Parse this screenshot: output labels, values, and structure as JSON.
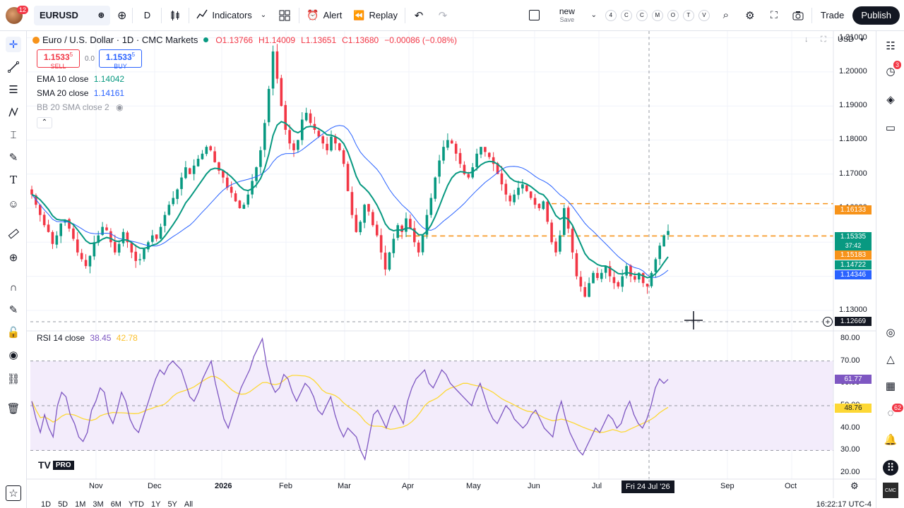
{
  "topbar": {
    "avatar_badge": "12",
    "symbol": "EURUSD",
    "interval": "D",
    "indicators_label": "Indicators",
    "alert_label": "Alert",
    "replay_label": "Replay",
    "layout_name": "new",
    "layout_save": "Save",
    "shortcut_keys": [
      "4",
      "C",
      "C",
      "M",
      "O",
      "T",
      "V"
    ],
    "trade_label": "Trade",
    "publish_label": "Publish"
  },
  "legend": {
    "title": "Euro / U.S. Dollar · 1D · CMC Markets",
    "open": "O1.13766",
    "high": "H1.14009",
    "low": "L1.13651",
    "close": "C1.13680",
    "change": "−0.00086 (−0.08%)",
    "sell_price": "1.1533",
    "sell_sup": "5",
    "sell_label": "SELL",
    "spread": "0.0",
    "buy_price": "1.1533",
    "buy_sup": "5",
    "buy_label": "BUY",
    "ema_label": "EMA 10 close",
    "ema_value": "1.14042",
    "sma_label": "SMA 20 close",
    "sma_value": "1.14161",
    "bb_label": "BB 20 SMA close 2"
  },
  "currency": "USD",
  "price_axis": [
    "1.21000",
    "1.20000",
    "1.19000",
    "1.18000",
    "1.17000",
    "1.16000",
    "1.15000",
    "1.14000",
    "1.13000"
  ],
  "price_labels": {
    "orange_top": "1.16133",
    "current": "1.15335",
    "countdown": "37:42",
    "orange_mid": "1.15183",
    "ema_tag": "1.14722",
    "sma_tag": "1.14346",
    "crosshair": "1.12669"
  },
  "rsi": {
    "label": "RSI 14 close",
    "value1": "38.45",
    "value2": "42.78",
    "axis": [
      "80.00",
      "70.00",
      "60.00",
      "50.00",
      "40.00",
      "30.00",
      "20.00"
    ],
    "tag1": "61.77",
    "tag2": "48.76"
  },
  "time_axis": [
    "Nov",
    "Dec",
    "2026",
    "Feb",
    "Mar",
    "Apr",
    "May",
    "Jun",
    "Jul",
    "Sep",
    "Oct"
  ],
  "crosshair_date": "Fri 24 Jul '26",
  "logo_text": "PRO",
  "bottombar": {
    "ranges": [
      "1D",
      "5D",
      "1M",
      "3M",
      "6M",
      "YTD",
      "1Y",
      "5Y",
      "All"
    ],
    "clock": "16:22:17 UTC-4"
  },
  "right_badges": {
    "clock": "3",
    "notif": "62"
  },
  "colors": {
    "up": "#089981",
    "down": "#f23645",
    "ema": "#089981",
    "sma": "#2962ff",
    "orange": "#f7931a",
    "rsi_line": "#7e57c2",
    "rsi_ma": "#fdd835",
    "rsi_band": "#f3ecfb"
  },
  "chart_data": {
    "type": "candlestick",
    "symbol": "EURUSD",
    "closes": [
      1.164,
      1.161,
      1.158,
      1.155,
      1.153,
      1.1495,
      1.152,
      1.1555,
      1.1565,
      1.154,
      1.151,
      1.147,
      1.145,
      1.143,
      1.146,
      1.15,
      1.152,
      1.1545,
      1.1535,
      1.15,
      1.147,
      1.1495,
      1.153,
      1.15,
      1.147,
      1.1445,
      1.145,
      1.148,
      1.15,
      1.152,
      1.151,
      1.1545,
      1.158,
      1.161,
      1.163,
      1.1655,
      1.169,
      1.172,
      1.17,
      1.1725,
      1.1745,
      1.176,
      1.178,
      1.177,
      1.1735,
      1.171,
      1.169,
      1.166,
      1.1645,
      1.162,
      1.16,
      1.161,
      1.164,
      1.168,
      1.172,
      1.177,
      1.185,
      1.195,
      1.206,
      1.198,
      1.19,
      1.183,
      1.179,
      1.177,
      1.18,
      1.186,
      1.188,
      1.185,
      1.183,
      1.181,
      1.179,
      1.177,
      1.181,
      1.179,
      1.177,
      1.173,
      1.165,
      1.158,
      1.153,
      1.156,
      1.161,
      1.159,
      1.155,
      1.152,
      1.147,
      1.142,
      1.147,
      1.151,
      1.155,
      1.153,
      1.157,
      1.154,
      1.15,
      1.147,
      1.152,
      1.158,
      1.163,
      1.169,
      1.174,
      1.178,
      1.18,
      1.179,
      1.176,
      1.173,
      1.17,
      1.169,
      1.172,
      1.176,
      1.178,
      1.1765,
      1.175,
      1.173,
      1.17,
      1.167,
      1.164,
      1.162,
      1.164,
      1.166,
      1.167,
      1.165,
      1.163,
      1.161,
      1.16,
      1.162,
      1.156,
      1.15,
      1.147,
      1.152,
      1.16,
      1.154,
      1.147,
      1.14,
      1.137,
      1.134,
      1.138,
      1.141,
      1.1395,
      1.141,
      1.143,
      1.14,
      1.138,
      1.137,
      1.14,
      1.143,
      1.14,
      1.139,
      1.141,
      1.138,
      1.137,
      1.141,
      1.145,
      1.149,
      1.152,
      1.1533
    ],
    "ema10_last": 1.14042,
    "sma20_last": 1.14161,
    "ylim": [
      1.125,
      1.212
    ],
    "rsi": [
      52,
      44,
      38,
      46,
      40,
      36,
      50,
      56,
      54,
      46,
      42,
      36,
      34,
      38,
      48,
      52,
      58,
      56,
      46,
      42,
      48,
      56,
      52,
      44,
      40,
      38,
      44,
      50,
      56,
      62,
      66,
      64,
      68,
      70,
      68,
      66,
      60,
      54,
      52,
      56,
      62,
      66,
      70,
      60,
      52,
      44,
      40,
      46,
      52,
      58,
      62,
      66,
      72,
      76,
      80,
      68,
      60,
      56,
      58,
      64,
      62,
      56,
      52,
      56,
      60,
      58,
      54,
      48,
      46,
      50,
      54,
      46,
      40,
      36,
      40,
      38,
      36,
      30,
      26,
      36,
      46,
      48,
      44,
      40,
      46,
      50,
      46,
      42,
      52,
      58,
      62,
      64,
      66,
      60,
      58,
      62,
      66,
      64,
      60,
      58,
      56,
      54,
      52,
      50,
      56,
      60,
      54,
      48,
      44,
      42,
      46,
      50,
      48,
      44,
      42,
      40,
      42,
      46,
      48,
      44,
      40,
      38,
      36,
      46,
      52,
      44,
      38,
      34,
      30,
      28,
      32,
      36,
      40,
      38,
      42,
      46,
      44,
      40,
      42,
      48,
      52,
      46,
      42,
      40,
      44,
      50,
      58,
      62,
      60,
      61.77
    ],
    "rsi_ma_last": 48.76,
    "rsi_levels": [
      70,
      50,
      30
    ],
    "rsi_ylim": [
      20,
      80
    ],
    "orange_levels": [
      1.16133,
      1.15183
    ],
    "x_labels": [
      "Nov",
      "Dec",
      "2026",
      "Feb",
      "Mar",
      "Apr",
      "May",
      "Jun",
      "Jul",
      "Sep",
      "Oct"
    ]
  }
}
